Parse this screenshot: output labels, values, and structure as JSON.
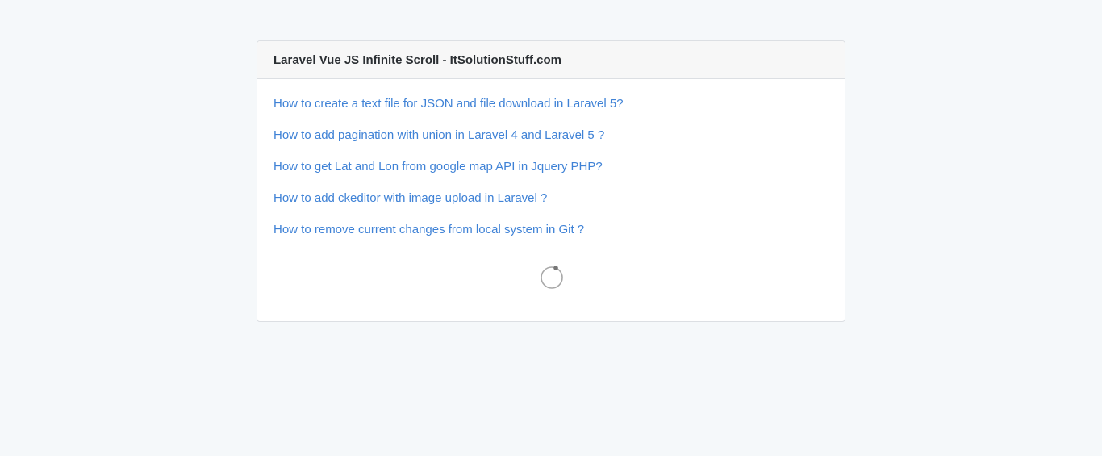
{
  "card": {
    "title": "Laravel Vue JS Infinite Scroll - ItSolutionStuff.com"
  },
  "posts": [
    {
      "title": "How to create a text file for JSON and file download in Laravel 5?"
    },
    {
      "title": "How to add pagination with union in Laravel 4 and Laravel 5 ?"
    },
    {
      "title": "How to get Lat and Lon from google map API in Jquery PHP?"
    },
    {
      "title": "How to add ckeditor with image upload in Laravel ?"
    },
    {
      "title": "How to remove current changes from local system in Git ?"
    }
  ],
  "loader": {
    "icon": "loading-spinner-icon",
    "ring_color": "#a8a8a8",
    "dot_color": "#777777"
  },
  "colors": {
    "background": "#f5f8fa",
    "link": "#3f82d6",
    "header_bg": "#f7f7f7",
    "border": "#dcdfe3"
  }
}
